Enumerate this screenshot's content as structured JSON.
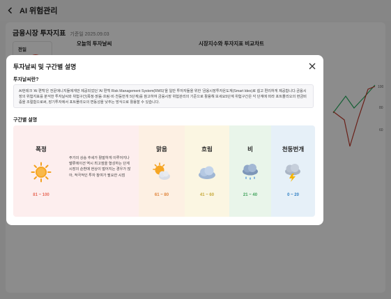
{
  "header": {
    "title": "AI 위험관리"
  },
  "card": {
    "title": "금융시장 투자지표",
    "date": "기준일 2025.09.03",
    "prev_label": "전일",
    "today_section": "오늘의 투자날씨",
    "compare_section": "시장지수와 투자지표 비교차트",
    "chart_ticks": [
      "100",
      "80",
      "60"
    ],
    "chart_colors": {
      "green": "#27ae60",
      "red": "#c0392b"
    }
  },
  "modal": {
    "title": "투자날씨 및 구간별 설명",
    "question": "투자날씨란?",
    "description": "AI헌테크 'AI 편백'은 전문애니지들에게만 제공되었던 'AI 편백 Risk Management System(RMS)'을 일반 투자자들을 위한 '금융시장투자온도계(Smart Idex)로 쉽고 편리하게 제공합니다.금융시장의 위험지표를 분석한 투자날씨와 위험구간(폭정·맑음·흐림·비·천둥번개 5단계)를 참고하여 금융시장 위험관리의 기준으로 활용해 보세요5단계 위험구간은 각 단계에 따라 포트폴리오의 현금비중을 조절함으로써, 장기투자에서 포트폴리오의 변동성을 낮추는 방식으로 활용할 수 있습니다.",
    "segments_label": "구간별 설명",
    "segments": [
      {
        "name": "폭정",
        "range": "81 ~ 100",
        "icon": "sun-icon",
        "bg": "#fdeeee",
        "range_color": "#e86a5a",
        "text": "주가의 상승 추세가 활발하게 이루어지나 밸류에이션 역시 최고점을 형성하는 단계 시장의 순환매 현상이 벌어지는 경우가 많아, 적극적인 투자 참여가 필요한 시점"
      },
      {
        "name": "맑음",
        "range": "61 ~ 80",
        "icon": "sun-cloud-icon",
        "bg": "#fdf0e3",
        "range_color": "#e0843a"
      },
      {
        "name": "흐림",
        "range": "41 ~ 60",
        "icon": "cloud-icon",
        "bg": "#fbf6e2",
        "range_color": "#c6a93a"
      },
      {
        "name": "비",
        "range": "21 ~ 40",
        "icon": "rain-cloud-icon",
        "bg": "#e9f5ea",
        "range_color": "#3fa25a"
      },
      {
        "name": "천둥번개",
        "range": "0 ~ 20",
        "icon": "thunder-cloud-icon",
        "bg": "#e6f0f8",
        "range_color": "#2f7fc4"
      }
    ]
  }
}
